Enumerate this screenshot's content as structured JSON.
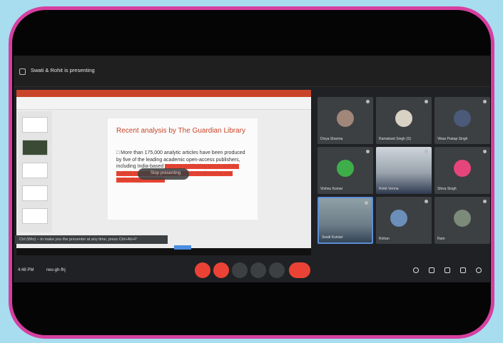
{
  "topbar": {
    "presenting_text": "Swati & Rohit is presenting"
  },
  "slide": {
    "title": "Recent analysis by The Guardian Library",
    "body_lead": "□ More than 175,000 analytic articles have been produced by five of the leading academic open-access publishers, including India-based ",
    "body_highlight": "Science publishing group and the Turkish World Academy of Science, Engineering and Technology, or Waset."
  },
  "presenter_pill": {
    "label": "Stop presenting"
  },
  "toast": {
    "text": "Ctrl (Win) – to make you the presenter at any time, press Ctrl+Alt+P"
  },
  "participants": [
    {
      "name": "Divya Sharma"
    },
    {
      "name": "Ramakant Singh (S)"
    },
    {
      "name": "Vikas Pratap Singh"
    },
    {
      "name": "Vishnu Kumar"
    },
    {
      "name": "Rohit Verma"
    },
    {
      "name": "Shiva Singh"
    },
    {
      "name": "Swati Kumari"
    },
    {
      "name": "Rohan"
    },
    {
      "name": "Ram"
    }
  ],
  "bottombar": {
    "time": "4:48 PM",
    "meeting_code": "rwu-gh-fhj"
  },
  "colors": {
    "frame": "#d63fa0",
    "background": "#a8dcef",
    "accent_red": "#ea4335",
    "slide_title": "#c8452a"
  }
}
